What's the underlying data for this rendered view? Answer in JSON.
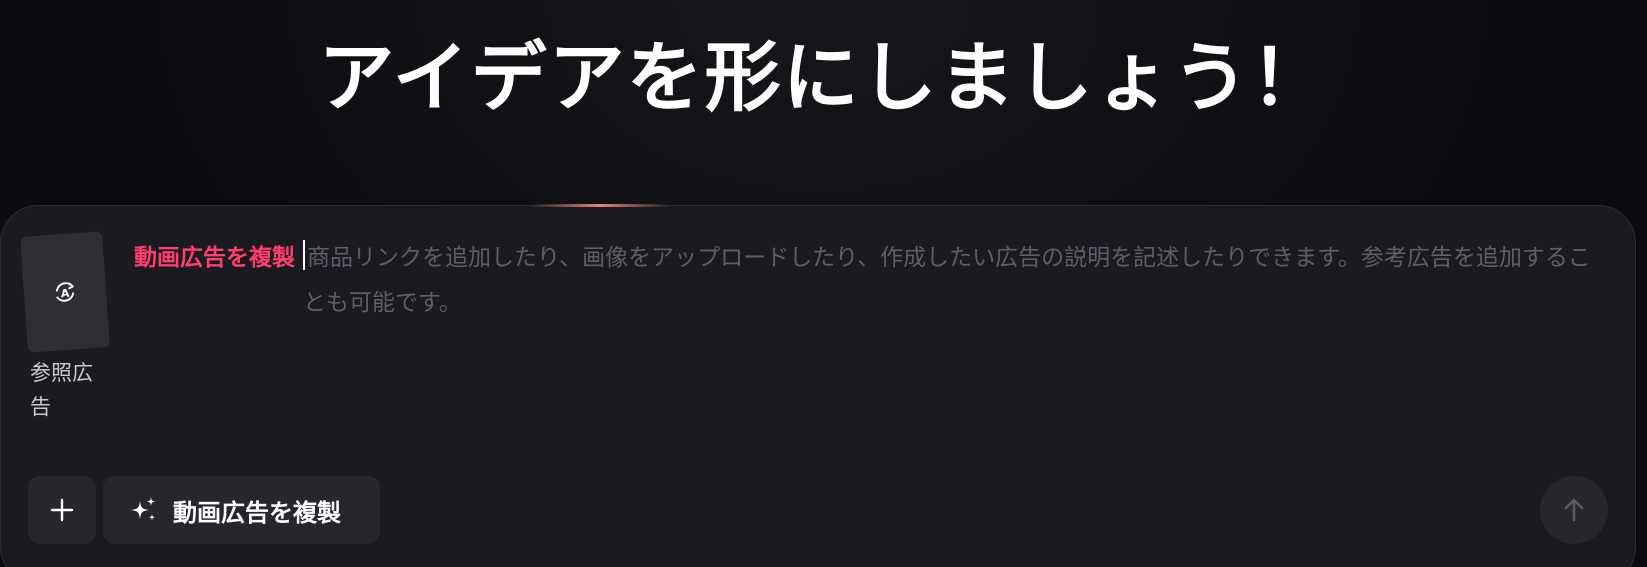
{
  "hero": {
    "title": "アイデアを形にしましょう！"
  },
  "composer": {
    "reference_card": {
      "icon": "ai-refresh-icon",
      "label": "参照広告"
    },
    "mode_tag": "動画広告を複製",
    "placeholder": "商品リンクを追加したり、画像をアップロードしたり、作成したい広告の説明を記述したりできます。参考広告を追加することも可能です。",
    "add_button": {
      "icon": "plus-icon"
    },
    "mode_button": {
      "icon": "sparkle-icon",
      "label": "動画広告を複製"
    },
    "send_button": {
      "icon": "arrow-up-icon"
    }
  },
  "colors": {
    "accent_pink": "#ff3d6e",
    "background": "#0c0c10",
    "panel": "#1a1a21",
    "button": "#26262d",
    "placeholder": "#5e5e66"
  }
}
